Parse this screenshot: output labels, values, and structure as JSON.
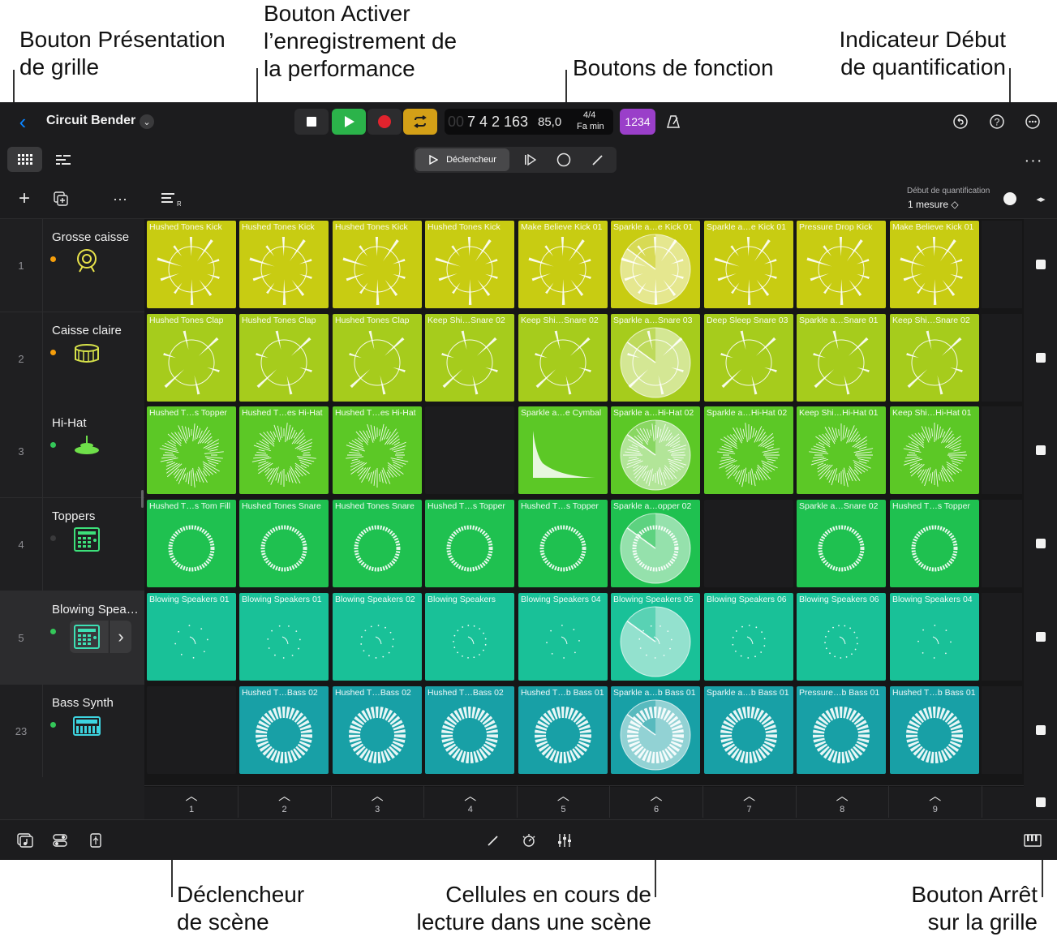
{
  "callouts": {
    "grid_view": [
      "Bouton Présentation",
      "de grille"
    ],
    "perf_record": [
      "Bouton Activer",
      "l’enregistrement de",
      "la performance"
    ],
    "function_buttons": [
      "Boutons de fonction"
    ],
    "quant_start": [
      "Indicateur Début",
      "de quantification"
    ],
    "scene_trigger": [
      "Déclencheur",
      "de scène"
    ],
    "playing_cells": [
      "Cellules en cours de",
      "lecture dans une scène"
    ],
    "grid_stop": [
      "Bouton Arrêt",
      "sur la grille"
    ]
  },
  "header": {
    "project_title": "Circuit Bender",
    "lcd": {
      "ghost": "00",
      "position": "7 4 2 163",
      "tempo": "85,0",
      "signature": "4/4",
      "key": "Fa min"
    },
    "count_in": "1234"
  },
  "function_bar": {
    "trigger_label": "Déclencheur"
  },
  "quantize": {
    "label": "Début de quantification",
    "value": "1 mesure ◇"
  },
  "colors": {
    "row1": "#c8cc12",
    "row2": "#a6cc1c",
    "row3": "#5cc826",
    "row4": "#1fc150",
    "row5": "#19c198",
    "row6": "#18a0a6",
    "accent_blue": "#0a84ff",
    "record": "#e0232d",
    "play": "#2bb34a",
    "cycle": "#d4a017",
    "count_in": "#9a3fc9"
  },
  "tracks": [
    {
      "num": "1",
      "name": "Grosse caisse",
      "dot": "#f59e0b",
      "icon": "kick-drum-icon"
    },
    {
      "num": "2",
      "name": "Caisse claire",
      "dot": "#f59e0b",
      "icon": "snare-drum-icon"
    },
    {
      "num": "3",
      "name": "Hi-Hat",
      "dot": "#34c759",
      "icon": "hihat-icon"
    },
    {
      "num": "4",
      "name": "Toppers",
      "dot": "#3a3a3c",
      "icon": "drum-machine-icon"
    },
    {
      "num": "5",
      "name": "Blowing Spea…",
      "dot": "#34c759",
      "icon": "drum-machine-icon"
    },
    {
      "num": "23",
      "name": "Bass Synth",
      "dot": "#34c759",
      "icon": "synth-icon"
    }
  ],
  "grid": [
    [
      "Hushed Tones Kick",
      "Hushed Tones Kick",
      "Hushed Tones Kick",
      "Hushed Tones Kick",
      "Make Believe Kick 01",
      "Sparkle a…e Kick 01",
      "Sparkle a…e Kick 01",
      "Pressure Drop Kick",
      "Make Believe Kick 01"
    ],
    [
      "Hushed Tones Clap",
      "Hushed Tones Clap",
      "Hushed Tones Clap",
      "Keep Shi…Snare 02",
      "Keep Shi…Snare 02",
      "Sparkle a…Snare 03",
      "Deep Sleep Snare 03",
      "Sparkle a…Snare 01",
      "Keep Shi…Snare 02"
    ],
    [
      "Hushed T…s Topper",
      "Hushed T…es Hi-Hat",
      "Hushed T…es Hi-Hat",
      "",
      "Sparkle a…e Cymbal",
      "Sparkle a…Hi-Hat 02",
      "Sparkle a…Hi-Hat 02",
      "Keep Shi…Hi-Hat 01",
      "Keep Shi…Hi-Hat 01"
    ],
    [
      "Hushed T…s Tom Fill",
      "Hushed Tones Snare",
      "Hushed Tones Snare",
      "Hushed T…s Topper",
      "Hushed T…s Topper",
      "Sparkle a…opper 02",
      "",
      "Sparkle a…Snare 02",
      "Hushed T…s Topper"
    ],
    [
      "Blowing Speakers 01",
      "Blowing Speakers 01",
      "Blowing Speakers 02",
      "Blowing Speakers",
      "Blowing Speakers 04",
      "Blowing Speakers 05",
      "Blowing Speakers 06",
      "Blowing Speakers 06",
      "Blowing Speakers 04"
    ],
    [
      "",
      "Hushed T…Bass 02",
      "Hushed T…Bass 02",
      "Hushed T…Bass 02",
      "Hushed T…b Bass 01",
      "Sparkle a…b Bass 01",
      "Sparkle a…b Bass 01",
      "Pressure…b Bass 01",
      "Hushed T…b Bass 01"
    ]
  ],
  "scenes": [
    "1",
    "2",
    "3",
    "4",
    "5",
    "6",
    "7",
    "8",
    "9"
  ]
}
